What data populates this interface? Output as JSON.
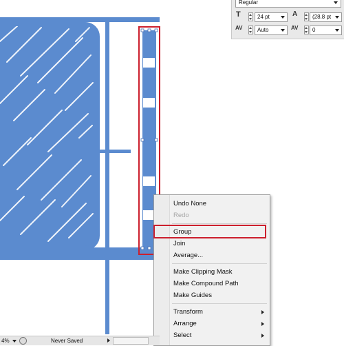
{
  "character_panel": {
    "font_style": "Regular",
    "font_size": "24 pt",
    "leading": "(28.8 pt",
    "kerning": "Auto",
    "tracking": "0",
    "icons": [
      "font-size-icon",
      "leading-icon",
      "kerning-icon",
      "tracking-icon"
    ]
  },
  "context_menu": {
    "items": [
      {
        "label": "Undo None",
        "enabled": true
      },
      {
        "label": "Redo",
        "enabled": false
      },
      {
        "label": "Group",
        "enabled": true
      },
      {
        "label": "Join",
        "enabled": true
      },
      {
        "label": "Average...",
        "enabled": true
      },
      {
        "label": "Make Clipping Mask",
        "enabled": true
      },
      {
        "label": "Make Compound Path",
        "enabled": true
      },
      {
        "label": "Make Guides",
        "enabled": true
      },
      {
        "label": "Transform",
        "enabled": true,
        "submenu": true
      },
      {
        "label": "Arrange",
        "enabled": true,
        "submenu": true
      },
      {
        "label": "Select",
        "enabled": true,
        "submenu": true
      }
    ]
  },
  "status_bar": {
    "zoom": "4%",
    "document_state": "Never Saved"
  },
  "colors": {
    "artwork_blue": "#5b8bcf",
    "highlight_red": "#cc1f2d",
    "menu_bg": "#f1f1f1"
  }
}
